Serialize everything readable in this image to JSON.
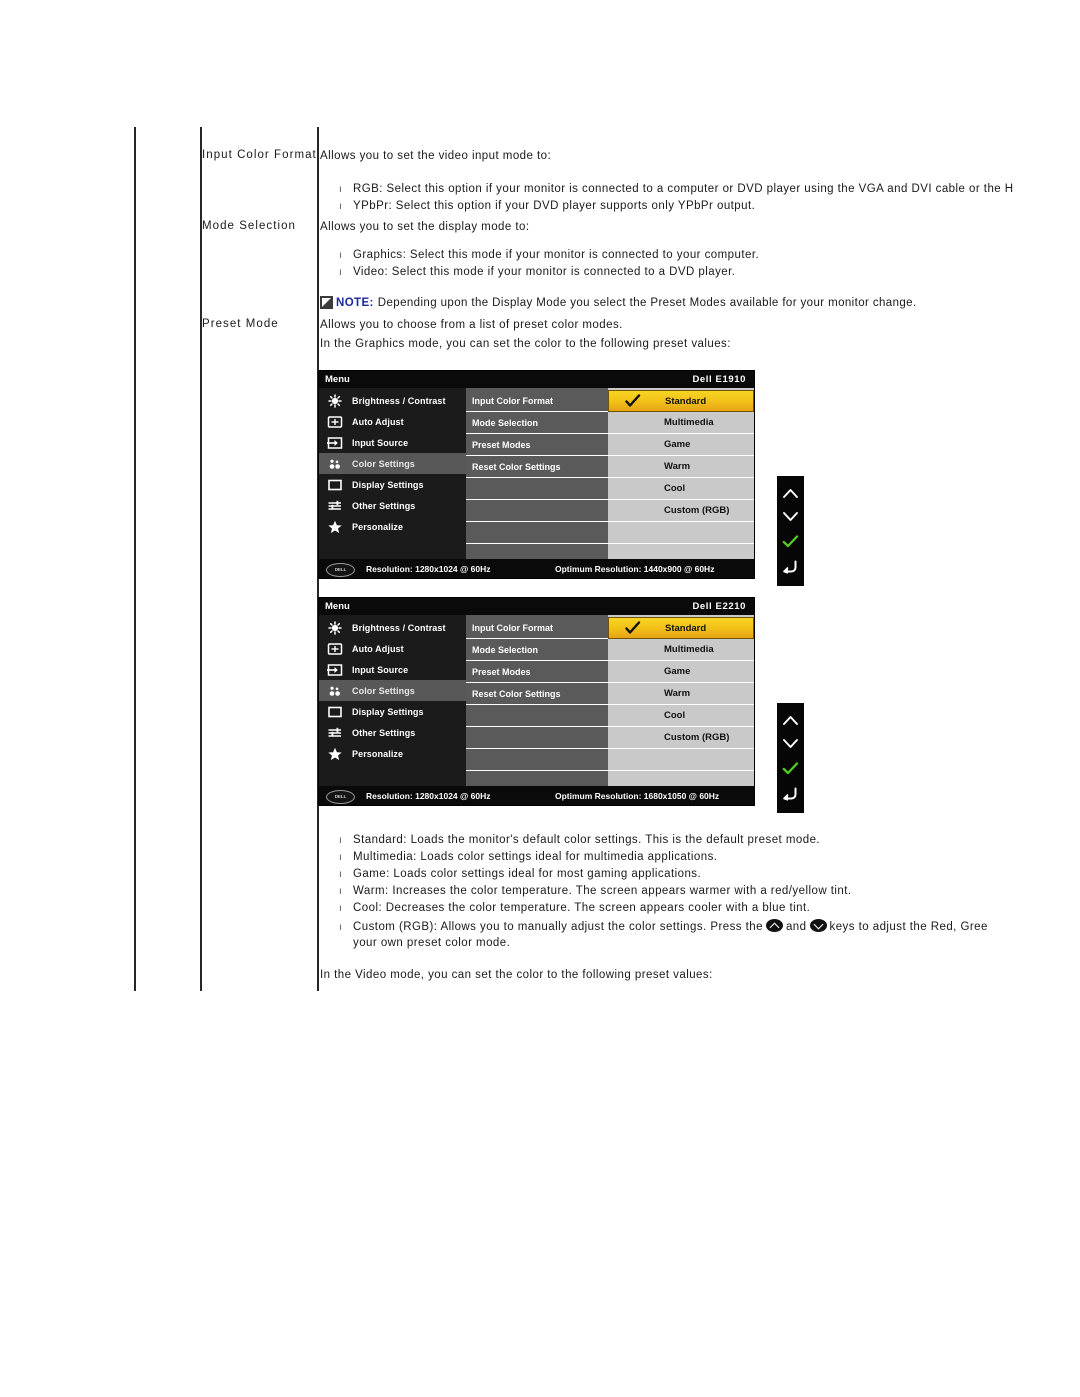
{
  "document": {
    "rows": [
      {
        "label": "Input Color Format",
        "intro": "Allows you to set the video input mode to:",
        "bullets": [
          "RGB: Select this option if your monitor is connected to a computer or DVD player using the VGA and DVI cable or the H",
          "YPbPr: Select this option if your DVD player supports only YPbPr output."
        ]
      },
      {
        "label": "Mode Selection",
        "intro": "Allows you to set the display mode to:",
        "bullets": [
          "Graphics: Select this mode if your monitor is connected to your computer.",
          "Video: Select this mode if your monitor is connected to a DVD player."
        ]
      },
      {
        "label": "Preset Mode",
        "intro": "Allows you to choose from a list of preset color modes.",
        "intro2": "In the Graphics mode, you can set the color to the following preset values:"
      }
    ],
    "note": {
      "word": "NOTE:",
      "text": "Depending upon the Display Mode you select the Preset Modes available for your monitor change.",
      "icon": "note-pencil-icon",
      "color": "#1a2a9c"
    },
    "preset_descriptions": [
      "Standard: Loads the monitor's default color settings. This is the default preset mode.",
      "Multimedia: Loads color settings ideal for multimedia applications.",
      "Game: Loads color settings ideal for most gaming applications.",
      "Warm: Increases the color temperature. The screen appears warmer with a red/yellow tint.",
      "Cool: Decreases the color temperature. The screen appears cooler with a blue tint."
    ],
    "custom_rgb": {
      "part1": "Custom (RGB): Allows you to manually adjust the color settings. Press the",
      "part2": "and",
      "part3": "keys to adjust the Red, Gree",
      "line2": "your own preset color mode."
    },
    "video_mode_line": "In the Video mode, you can set the color to the following preset values:"
  },
  "osd_common": {
    "menu_title": "Menu",
    "nav_items": [
      {
        "label": "Brightness / Contrast",
        "icon": "brightness-icon",
        "active": false
      },
      {
        "label": "Auto Adjust",
        "icon": "auto-adjust-icon",
        "active": false
      },
      {
        "label": "Input Source",
        "icon": "input-source-icon",
        "active": false
      },
      {
        "label": "Color Settings",
        "icon": "color-settings-icon",
        "active": true
      },
      {
        "label": "Display Settings",
        "icon": "display-settings-icon",
        "active": false
      },
      {
        "label": "Other Settings",
        "icon": "other-settings-icon",
        "active": false
      },
      {
        "label": "Personalize",
        "icon": "star-icon",
        "active": false
      }
    ],
    "submenu_items": [
      "Input Color Format",
      "Mode Selection",
      "Preset Modes",
      "Reset Color Settings",
      "",
      "",
      "",
      ""
    ],
    "values": [
      {
        "label": "Standard",
        "selected": true
      },
      {
        "label": "Multimedia",
        "selected": false
      },
      {
        "label": "Game",
        "selected": false
      },
      {
        "label": "Warm",
        "selected": false
      },
      {
        "label": "Cool",
        "selected": false
      },
      {
        "label": "Custom (RGB)",
        "selected": false
      },
      {
        "label": "",
        "selected": false
      },
      {
        "label": "",
        "selected": false
      }
    ],
    "dell_badge_text": "DELL",
    "resolution_left": "Resolution: 1280x1024 @ 60Hz",
    "selected_color": "#f2c117",
    "check_color": "#111111",
    "keys": [
      {
        "name": "up-chevron-key",
        "glyph": "chevron-up"
      },
      {
        "name": "down-chevron-key",
        "glyph": "chevron-down"
      },
      {
        "name": "confirm-key",
        "glyph": "check",
        "color": "#55cc22"
      },
      {
        "name": "back-key",
        "glyph": "back-arrow"
      }
    ]
  },
  "osd_panels": [
    {
      "model": "Dell  E1910",
      "optimum": "Optimum Resolution: 1440x900 @ 60Hz"
    },
    {
      "model": "Dell  E2210",
      "optimum": "Optimum Resolution: 1680x1050 @ 60Hz"
    }
  ]
}
